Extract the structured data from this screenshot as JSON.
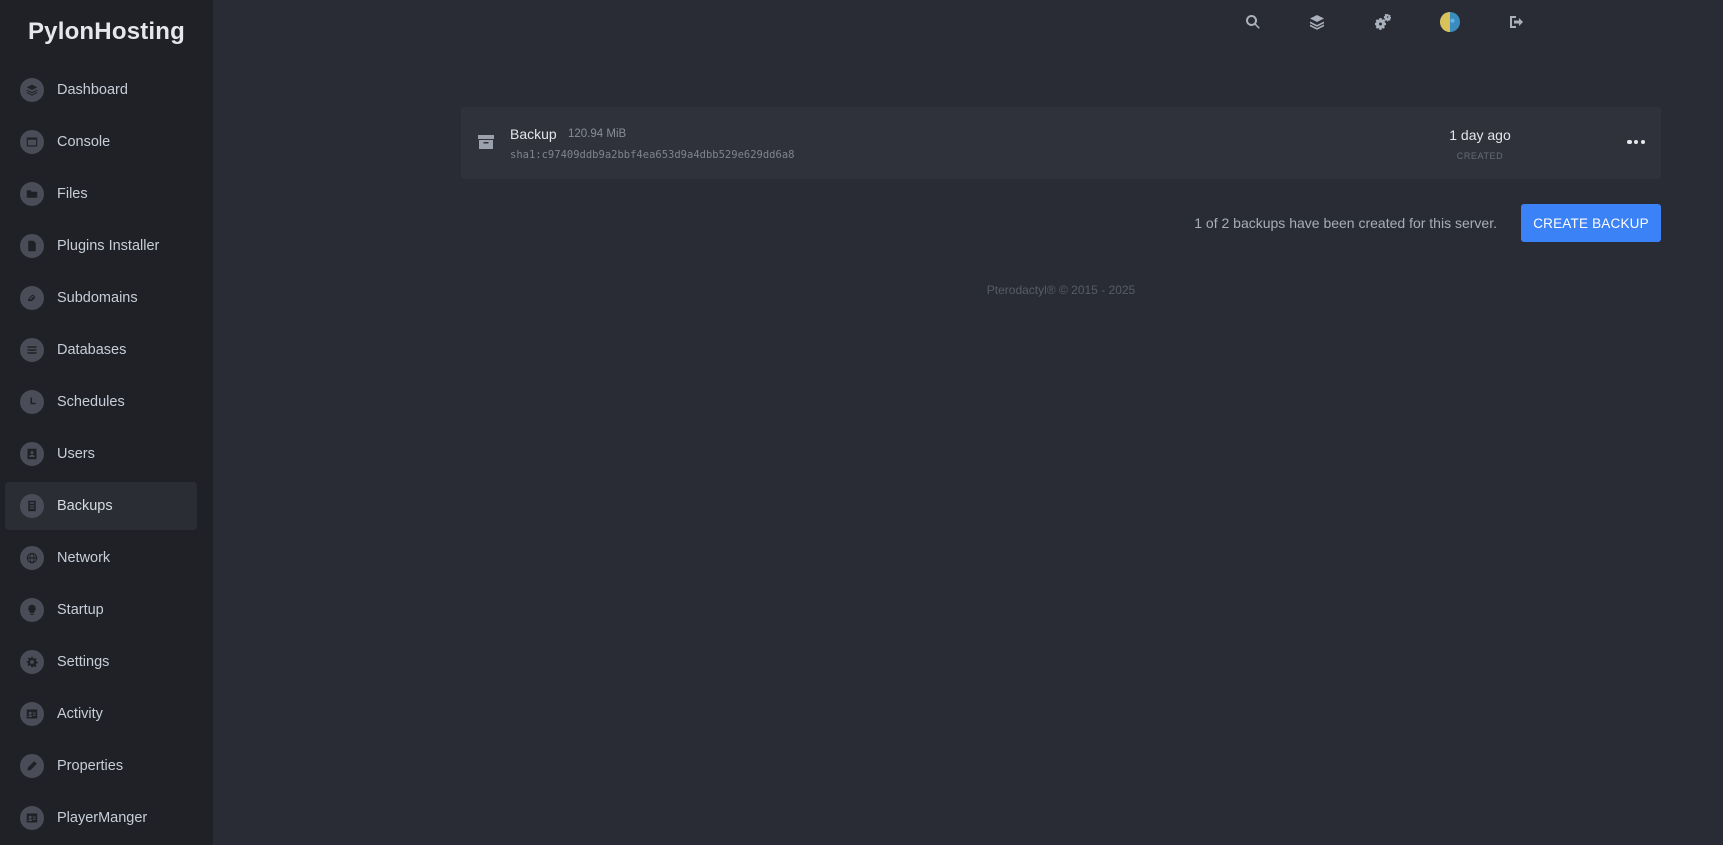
{
  "brand": "PylonHosting",
  "sidebar": {
    "items": [
      {
        "label": "Dashboard",
        "icon": "layers-icon"
      },
      {
        "label": "Console",
        "icon": "terminal-icon"
      },
      {
        "label": "Files",
        "icon": "folder-icon"
      },
      {
        "label": "Plugins Installer",
        "icon": "file-icon"
      },
      {
        "label": "Subdomains",
        "icon": "link-icon"
      },
      {
        "label": "Databases",
        "icon": "database-icon"
      },
      {
        "label": "Schedules",
        "icon": "clock-icon"
      },
      {
        "label": "Users",
        "icon": "user-card-icon"
      },
      {
        "label": "Backups",
        "icon": "archive-icon",
        "active": true
      },
      {
        "label": "Network",
        "icon": "globe-icon"
      },
      {
        "label": "Startup",
        "icon": "lightbulb-icon"
      },
      {
        "label": "Settings",
        "icon": "gear-icon"
      },
      {
        "label": "Activity",
        "icon": "id-card-icon"
      },
      {
        "label": "Properties",
        "icon": "pencil-icon"
      },
      {
        "label": "PlayerManger",
        "icon": "id-card-icon"
      }
    ]
  },
  "topbar": {
    "icons": [
      "search-icon",
      "layers-icon",
      "cogs-icon",
      "avatar",
      "sign-out-icon"
    ]
  },
  "backup": {
    "name": "Backup",
    "size": "120.94 MiB",
    "hash": "sha1:c97409ddb9a2bbf4ea653d9a4dbb529e629dd6a8",
    "time": "1 day ago",
    "created_label": "CREATED"
  },
  "footer": {
    "count_text": "1 of 2 backups have been created for this server.",
    "create_button": "CREATE BACKUP",
    "copyright": "Pterodactyl® © 2015 - 2025"
  },
  "colors": {
    "background": "#2a2c35",
    "sidebar": "#1f2126",
    "accent": "#3b82f6"
  }
}
